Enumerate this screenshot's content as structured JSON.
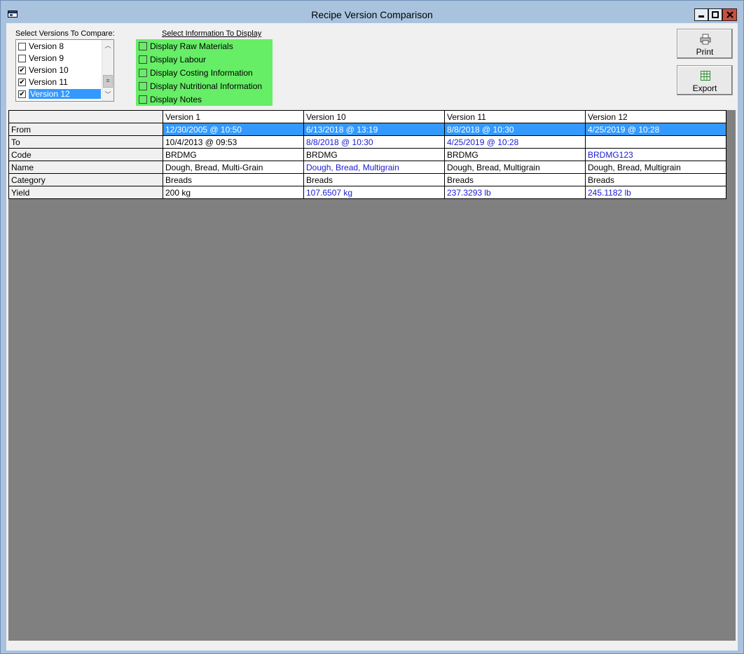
{
  "window": {
    "title": "Recipe Version Comparison"
  },
  "versions_panel": {
    "label": "Select Versions To Compare:",
    "items": [
      {
        "label": "Version 8",
        "checked": false,
        "selected": false
      },
      {
        "label": "Version 9",
        "checked": false,
        "selected": false
      },
      {
        "label": "Version 10",
        "checked": true,
        "selected": false
      },
      {
        "label": "Version 11",
        "checked": true,
        "selected": false
      },
      {
        "label": "Version 12",
        "checked": true,
        "selected": true
      }
    ]
  },
  "info_panel": {
    "label": "Select Information To Display",
    "options": [
      {
        "label": "Display Raw Materials",
        "checked": false
      },
      {
        "label": "Display Labour",
        "checked": false
      },
      {
        "label": "Display Costing Information",
        "checked": false
      },
      {
        "label": "Display Nutritional Information",
        "checked": false
      },
      {
        "label": "Display Notes",
        "checked": false
      }
    ]
  },
  "buttons": {
    "print": "Print",
    "export": "Export"
  },
  "table": {
    "columns": [
      "Version 1",
      "Version 10",
      "Version 11",
      "Version 12"
    ],
    "rows": [
      {
        "label": "From",
        "selected": true,
        "cells": [
          {
            "text": "12/30/2005 @ 10:50",
            "diff": false
          },
          {
            "text": "6/13/2018 @ 13:19",
            "diff": false
          },
          {
            "text": "8/8/2018 @ 10:30",
            "diff": false
          },
          {
            "text": "4/25/2019 @ 10:28",
            "diff": false
          }
        ]
      },
      {
        "label": "To",
        "selected": false,
        "cells": [
          {
            "text": "10/4/2013 @ 09:53",
            "diff": false
          },
          {
            "text": "8/8/2018 @ 10:30",
            "diff": true
          },
          {
            "text": "4/25/2019 @ 10:28",
            "diff": true
          },
          {
            "text": "",
            "diff": false
          }
        ]
      },
      {
        "label": "Code",
        "selected": false,
        "cells": [
          {
            "text": "BRDMG",
            "diff": false
          },
          {
            "text": "BRDMG",
            "diff": false
          },
          {
            "text": "BRDMG",
            "diff": false
          },
          {
            "text": "BRDMG123",
            "diff": true
          }
        ]
      },
      {
        "label": "Name",
        "selected": false,
        "cells": [
          {
            "text": "Dough, Bread, Multi-Grain",
            "diff": false
          },
          {
            "text": "Dough, Bread, Multigrain",
            "diff": true
          },
          {
            "text": "Dough, Bread, Multigrain",
            "diff": false
          },
          {
            "text": "Dough, Bread, Multigrain",
            "diff": false
          }
        ]
      },
      {
        "label": "Category",
        "selected": false,
        "cells": [
          {
            "text": "Breads",
            "diff": false
          },
          {
            "text": "Breads",
            "diff": false
          },
          {
            "text": "Breads",
            "diff": false
          },
          {
            "text": "Breads",
            "diff": false
          }
        ]
      },
      {
        "label": "Yield",
        "selected": false,
        "cells": [
          {
            "text": "200 kg",
            "diff": false
          },
          {
            "text": "107.6507 kg",
            "diff": true
          },
          {
            "text": "237.3293 lb",
            "diff": true
          },
          {
            "text": "245.1182 lb",
            "diff": true
          }
        ]
      }
    ]
  },
  "colors": {
    "diff_text": "#1a1ad4",
    "selection": "#3399ff",
    "info_panel_bg": "#66ee66",
    "grid_bg": "#808080"
  },
  "icons": {
    "app": "app-window-icon",
    "print": "printer-icon",
    "export": "spreadsheet-icon"
  }
}
